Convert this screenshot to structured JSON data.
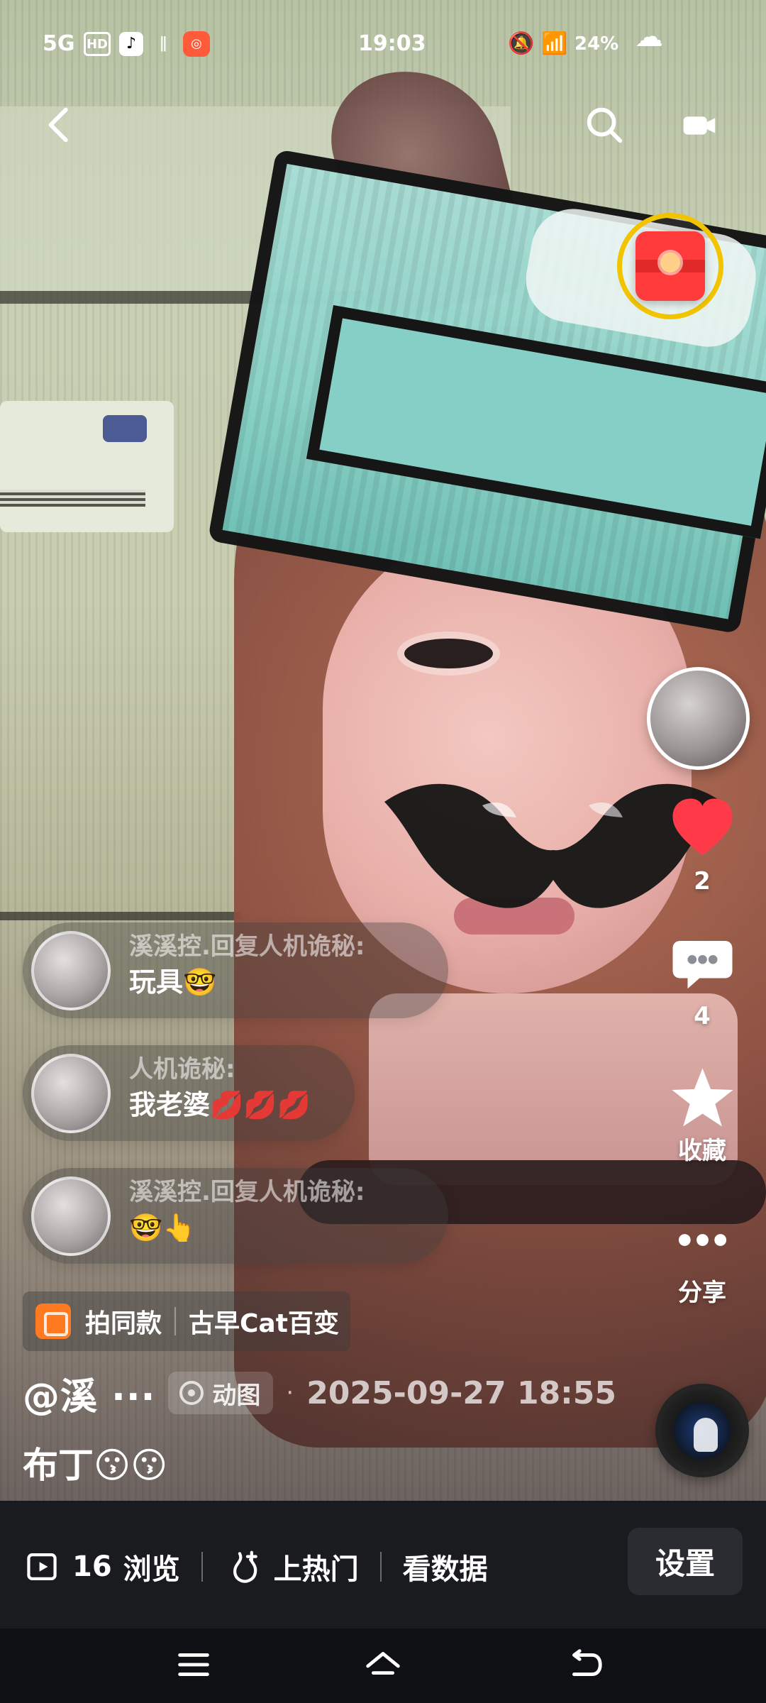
{
  "status_bar": {
    "network": "5G",
    "hd": "HD",
    "app_tiktok_icon": "tiktok-icon",
    "secondary_signal": "∥",
    "app_badge_icon": "app-badge-icon",
    "time": "19:03",
    "silent_icon": "mute-icon",
    "wifi_icon": "wifi-icon",
    "battery": "24%",
    "cloud_icon": "cloud-icon"
  },
  "top_actions": {
    "back_icon": "back-icon",
    "search_icon": "search-icon",
    "camera_icon": "camera-icon"
  },
  "overlay": {
    "red_packet_icon": "red-packet-icon"
  },
  "right_rail": {
    "avatar_icon": "avatar",
    "like": {
      "icon": "heart-icon",
      "count": "2"
    },
    "comment": {
      "icon": "comment-icon",
      "count": "4"
    },
    "collect": {
      "icon": "star-icon",
      "label": "收藏"
    },
    "share": {
      "icon": "more-dots-icon",
      "label": "分享"
    },
    "music_disc_icon": "music-disc-icon"
  },
  "comments": [
    {
      "name": "溪溪控.回复人机诡秘:",
      "text": "玩具🤓"
    },
    {
      "name": "人机诡秘:",
      "text": "我老婆💋💋💋"
    },
    {
      "name": "溪溪控.回复人机诡秘:",
      "text": "🤓👆"
    }
  ],
  "same_style": {
    "label": "拍同款",
    "name": "古早Cat百变"
  },
  "post": {
    "author": "@溪 ···",
    "type_label": "动图",
    "dot": "·",
    "datetime": "2025-09-27  18:55",
    "caption": "布丁😗😗"
  },
  "bottom_bar": {
    "views_count": "16",
    "views_label": "浏览",
    "boost_label": "上热门",
    "data_label": "看数据",
    "settings_label": "设置"
  },
  "colors": {
    "accent_red": "#FF3B3B",
    "accent_yellow": "#F2C400",
    "bottom_bar_bg": "#1A1B1F"
  }
}
